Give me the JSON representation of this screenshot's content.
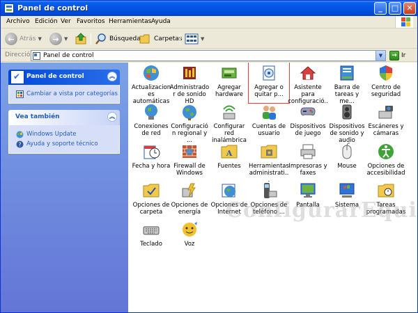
{
  "window": {
    "title": "Panel de control"
  },
  "menu": {
    "items": [
      "Archivo",
      "Edición",
      "Ver",
      "Favoritos",
      "Herramientas",
      "Ayuda"
    ],
    "underline": [
      "A",
      "E",
      "V",
      "F",
      "H",
      "y"
    ]
  },
  "toolbar": {
    "back_label": "Atrás",
    "search_label": "Búsqueda",
    "folders_label": "Carpetas"
  },
  "address": {
    "label": "Dirección",
    "value": "Panel de control",
    "go_label": "Ir"
  },
  "taskpane": {
    "panel1": {
      "title": "Panel de control",
      "link": "Cambiar a vista por categorías"
    },
    "panel2": {
      "title": "Vea también",
      "links": [
        "Windows Update",
        "Ayuda y soporte técnico"
      ]
    }
  },
  "items": [
    {
      "label": "Actualizaciones automáticas",
      "icon": "globe-shield-icon"
    },
    {
      "label": "Administrador de sonido HD",
      "icon": "audio-manager-icon"
    },
    {
      "label": "Agregar hardware",
      "icon": "add-hardware-icon"
    },
    {
      "label": "Agregar o quitar p...",
      "icon": "add-remove-programs-icon",
      "selected": true
    },
    {
      "label": "Asistente para configuració...",
      "icon": "network-setup-icon"
    },
    {
      "label": "Barra de tareas y me...",
      "icon": "taskbar-icon"
    },
    {
      "label": "Centro de seguridad",
      "icon": "security-shield-icon"
    },
    {
      "label": "Conexiones de red",
      "icon": "network-connections-icon"
    },
    {
      "label": "Configuración regional y ...",
      "icon": "regional-globe-icon"
    },
    {
      "label": "Configurar red inalámbrica",
      "icon": "wireless-icon"
    },
    {
      "label": "Cuentas de usuario",
      "icon": "user-accounts-icon"
    },
    {
      "label": "Dispositivos de juego",
      "icon": "gamepad-icon"
    },
    {
      "label": "Dispositivos de sonido y audio",
      "icon": "speaker-icon"
    },
    {
      "label": "Escáneres y cámaras",
      "icon": "scanner-camera-icon"
    },
    {
      "label": "Fecha y hora",
      "icon": "clock-icon"
    },
    {
      "label": "Firewall de Windows",
      "icon": "firewall-icon"
    },
    {
      "label": "Fuentes",
      "icon": "fonts-folder-icon"
    },
    {
      "label": "Herramientas administrati...",
      "icon": "admin-tools-icon"
    },
    {
      "label": "Impresoras y faxes",
      "icon": "printer-icon"
    },
    {
      "label": "Mouse",
      "icon": "mouse-icon"
    },
    {
      "label": "Opciones de accesibilidad",
      "icon": "accessibility-icon"
    },
    {
      "label": "Opciones de carpeta",
      "icon": "folder-options-icon"
    },
    {
      "label": "Opciones de energía",
      "icon": "power-icon"
    },
    {
      "label": "Opciones de Internet",
      "icon": "internet-options-icon"
    },
    {
      "label": "Opciones de teléfono ...",
      "icon": "phone-modem-icon"
    },
    {
      "label": "Pantalla",
      "icon": "display-icon"
    },
    {
      "label": "Sistema",
      "icon": "system-icon"
    },
    {
      "label": "Tareas programadas",
      "icon": "scheduled-tasks-icon"
    },
    {
      "label": "Teclado",
      "icon": "keyboard-icon"
    },
    {
      "label": "Voz",
      "icon": "speech-icon"
    }
  ],
  "watermark": "ConfigurarEquipos",
  "colors": {
    "titlebar": "#0454E3",
    "taskpane_top": "#7BA2E7",
    "taskpane_bottom": "#6375D6",
    "link": "#215DC6",
    "selection_outline": "#E04040"
  }
}
